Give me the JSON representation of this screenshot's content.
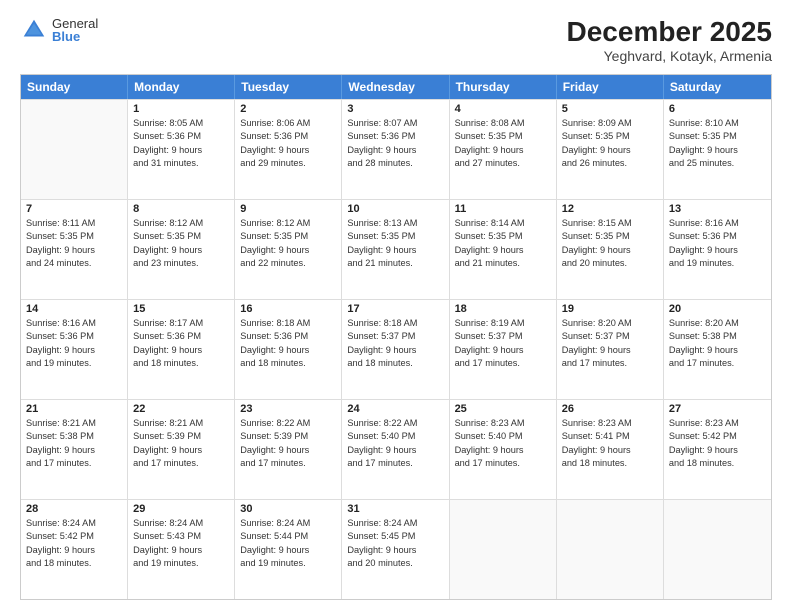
{
  "logo": {
    "general": "General",
    "blue": "Blue"
  },
  "header": {
    "month": "December 2025",
    "location": "Yeghvard, Kotayk, Armenia"
  },
  "days": [
    "Sunday",
    "Monday",
    "Tuesday",
    "Wednesday",
    "Thursday",
    "Friday",
    "Saturday"
  ],
  "weeks": [
    [
      {
        "day": "",
        "sunrise": "",
        "sunset": "",
        "daylight": ""
      },
      {
        "day": "1",
        "sunrise": "Sunrise: 8:05 AM",
        "sunset": "Sunset: 5:36 PM",
        "daylight": "Daylight: 9 hours and 31 minutes."
      },
      {
        "day": "2",
        "sunrise": "Sunrise: 8:06 AM",
        "sunset": "Sunset: 5:36 PM",
        "daylight": "Daylight: 9 hours and 29 minutes."
      },
      {
        "day": "3",
        "sunrise": "Sunrise: 8:07 AM",
        "sunset": "Sunset: 5:36 PM",
        "daylight": "Daylight: 9 hours and 28 minutes."
      },
      {
        "day": "4",
        "sunrise": "Sunrise: 8:08 AM",
        "sunset": "Sunset: 5:35 PM",
        "daylight": "Daylight: 9 hours and 27 minutes."
      },
      {
        "day": "5",
        "sunrise": "Sunrise: 8:09 AM",
        "sunset": "Sunset: 5:35 PM",
        "daylight": "Daylight: 9 hours and 26 minutes."
      },
      {
        "day": "6",
        "sunrise": "Sunrise: 8:10 AM",
        "sunset": "Sunset: 5:35 PM",
        "daylight": "Daylight: 9 hours and 25 minutes."
      }
    ],
    [
      {
        "day": "7",
        "sunrise": "Sunrise: 8:11 AM",
        "sunset": "Sunset: 5:35 PM",
        "daylight": "Daylight: 9 hours and 24 minutes."
      },
      {
        "day": "8",
        "sunrise": "Sunrise: 8:12 AM",
        "sunset": "Sunset: 5:35 PM",
        "daylight": "Daylight: 9 hours and 23 minutes."
      },
      {
        "day": "9",
        "sunrise": "Sunrise: 8:12 AM",
        "sunset": "Sunset: 5:35 PM",
        "daylight": "Daylight: 9 hours and 22 minutes."
      },
      {
        "day": "10",
        "sunrise": "Sunrise: 8:13 AM",
        "sunset": "Sunset: 5:35 PM",
        "daylight": "Daylight: 9 hours and 21 minutes."
      },
      {
        "day": "11",
        "sunrise": "Sunrise: 8:14 AM",
        "sunset": "Sunset: 5:35 PM",
        "daylight": "Daylight: 9 hours and 21 minutes."
      },
      {
        "day": "12",
        "sunrise": "Sunrise: 8:15 AM",
        "sunset": "Sunset: 5:35 PM",
        "daylight": "Daylight: 9 hours and 20 minutes."
      },
      {
        "day": "13",
        "sunrise": "Sunrise: 8:16 AM",
        "sunset": "Sunset: 5:36 PM",
        "daylight": "Daylight: 9 hours and 19 minutes."
      }
    ],
    [
      {
        "day": "14",
        "sunrise": "Sunrise: 8:16 AM",
        "sunset": "Sunset: 5:36 PM",
        "daylight": "Daylight: 9 hours and 19 minutes."
      },
      {
        "day": "15",
        "sunrise": "Sunrise: 8:17 AM",
        "sunset": "Sunset: 5:36 PM",
        "daylight": "Daylight: 9 hours and 18 minutes."
      },
      {
        "day": "16",
        "sunrise": "Sunrise: 8:18 AM",
        "sunset": "Sunset: 5:36 PM",
        "daylight": "Daylight: 9 hours and 18 minutes."
      },
      {
        "day": "17",
        "sunrise": "Sunrise: 8:18 AM",
        "sunset": "Sunset: 5:37 PM",
        "daylight": "Daylight: 9 hours and 18 minutes."
      },
      {
        "day": "18",
        "sunrise": "Sunrise: 8:19 AM",
        "sunset": "Sunset: 5:37 PM",
        "daylight": "Daylight: 9 hours and 17 minutes."
      },
      {
        "day": "19",
        "sunrise": "Sunrise: 8:20 AM",
        "sunset": "Sunset: 5:37 PM",
        "daylight": "Daylight: 9 hours and 17 minutes."
      },
      {
        "day": "20",
        "sunrise": "Sunrise: 8:20 AM",
        "sunset": "Sunset: 5:38 PM",
        "daylight": "Daylight: 9 hours and 17 minutes."
      }
    ],
    [
      {
        "day": "21",
        "sunrise": "Sunrise: 8:21 AM",
        "sunset": "Sunset: 5:38 PM",
        "daylight": "Daylight: 9 hours and 17 minutes."
      },
      {
        "day": "22",
        "sunrise": "Sunrise: 8:21 AM",
        "sunset": "Sunset: 5:39 PM",
        "daylight": "Daylight: 9 hours and 17 minutes."
      },
      {
        "day": "23",
        "sunrise": "Sunrise: 8:22 AM",
        "sunset": "Sunset: 5:39 PM",
        "daylight": "Daylight: 9 hours and 17 minutes."
      },
      {
        "day": "24",
        "sunrise": "Sunrise: 8:22 AM",
        "sunset": "Sunset: 5:40 PM",
        "daylight": "Daylight: 9 hours and 17 minutes."
      },
      {
        "day": "25",
        "sunrise": "Sunrise: 8:23 AM",
        "sunset": "Sunset: 5:40 PM",
        "daylight": "Daylight: 9 hours and 17 minutes."
      },
      {
        "day": "26",
        "sunrise": "Sunrise: 8:23 AM",
        "sunset": "Sunset: 5:41 PM",
        "daylight": "Daylight: 9 hours and 18 minutes."
      },
      {
        "day": "27",
        "sunrise": "Sunrise: 8:23 AM",
        "sunset": "Sunset: 5:42 PM",
        "daylight": "Daylight: 9 hours and 18 minutes."
      }
    ],
    [
      {
        "day": "28",
        "sunrise": "Sunrise: 8:24 AM",
        "sunset": "Sunset: 5:42 PM",
        "daylight": "Daylight: 9 hours and 18 minutes."
      },
      {
        "day": "29",
        "sunrise": "Sunrise: 8:24 AM",
        "sunset": "Sunset: 5:43 PM",
        "daylight": "Daylight: 9 hours and 19 minutes."
      },
      {
        "day": "30",
        "sunrise": "Sunrise: 8:24 AM",
        "sunset": "Sunset: 5:44 PM",
        "daylight": "Daylight: 9 hours and 19 minutes."
      },
      {
        "day": "31",
        "sunrise": "Sunrise: 8:24 AM",
        "sunset": "Sunset: 5:45 PM",
        "daylight": "Daylight: 9 hours and 20 minutes."
      },
      {
        "day": "",
        "sunrise": "",
        "sunset": "",
        "daylight": ""
      },
      {
        "day": "",
        "sunrise": "",
        "sunset": "",
        "daylight": ""
      },
      {
        "day": "",
        "sunrise": "",
        "sunset": "",
        "daylight": ""
      }
    ]
  ]
}
